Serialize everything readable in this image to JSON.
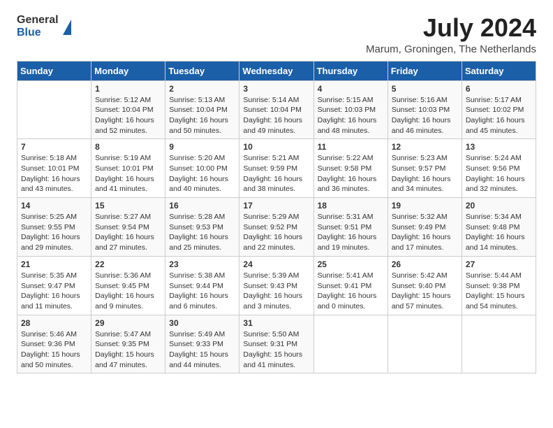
{
  "header": {
    "logo_general": "General",
    "logo_blue": "Blue",
    "title": "July 2024",
    "location": "Marum, Groningen, The Netherlands"
  },
  "weekdays": [
    "Sunday",
    "Monday",
    "Tuesday",
    "Wednesday",
    "Thursday",
    "Friday",
    "Saturday"
  ],
  "weeks": [
    [
      {
        "day": "",
        "content": ""
      },
      {
        "day": "1",
        "content": "Sunrise: 5:12 AM\nSunset: 10:04 PM\nDaylight: 16 hours\nand 52 minutes."
      },
      {
        "day": "2",
        "content": "Sunrise: 5:13 AM\nSunset: 10:04 PM\nDaylight: 16 hours\nand 50 minutes."
      },
      {
        "day": "3",
        "content": "Sunrise: 5:14 AM\nSunset: 10:04 PM\nDaylight: 16 hours\nand 49 minutes."
      },
      {
        "day": "4",
        "content": "Sunrise: 5:15 AM\nSunset: 10:03 PM\nDaylight: 16 hours\nand 48 minutes."
      },
      {
        "day": "5",
        "content": "Sunrise: 5:16 AM\nSunset: 10:03 PM\nDaylight: 16 hours\nand 46 minutes."
      },
      {
        "day": "6",
        "content": "Sunrise: 5:17 AM\nSunset: 10:02 PM\nDaylight: 16 hours\nand 45 minutes."
      }
    ],
    [
      {
        "day": "7",
        "content": "Sunrise: 5:18 AM\nSunset: 10:01 PM\nDaylight: 16 hours\nand 43 minutes."
      },
      {
        "day": "8",
        "content": "Sunrise: 5:19 AM\nSunset: 10:01 PM\nDaylight: 16 hours\nand 41 minutes."
      },
      {
        "day": "9",
        "content": "Sunrise: 5:20 AM\nSunset: 10:00 PM\nDaylight: 16 hours\nand 40 minutes."
      },
      {
        "day": "10",
        "content": "Sunrise: 5:21 AM\nSunset: 9:59 PM\nDaylight: 16 hours\nand 38 minutes."
      },
      {
        "day": "11",
        "content": "Sunrise: 5:22 AM\nSunset: 9:58 PM\nDaylight: 16 hours\nand 36 minutes."
      },
      {
        "day": "12",
        "content": "Sunrise: 5:23 AM\nSunset: 9:57 PM\nDaylight: 16 hours\nand 34 minutes."
      },
      {
        "day": "13",
        "content": "Sunrise: 5:24 AM\nSunset: 9:56 PM\nDaylight: 16 hours\nand 32 minutes."
      }
    ],
    [
      {
        "day": "14",
        "content": "Sunrise: 5:25 AM\nSunset: 9:55 PM\nDaylight: 16 hours\nand 29 minutes."
      },
      {
        "day": "15",
        "content": "Sunrise: 5:27 AM\nSunset: 9:54 PM\nDaylight: 16 hours\nand 27 minutes."
      },
      {
        "day": "16",
        "content": "Sunrise: 5:28 AM\nSunset: 9:53 PM\nDaylight: 16 hours\nand 25 minutes."
      },
      {
        "day": "17",
        "content": "Sunrise: 5:29 AM\nSunset: 9:52 PM\nDaylight: 16 hours\nand 22 minutes."
      },
      {
        "day": "18",
        "content": "Sunrise: 5:31 AM\nSunset: 9:51 PM\nDaylight: 16 hours\nand 19 minutes."
      },
      {
        "day": "19",
        "content": "Sunrise: 5:32 AM\nSunset: 9:49 PM\nDaylight: 16 hours\nand 17 minutes."
      },
      {
        "day": "20",
        "content": "Sunrise: 5:34 AM\nSunset: 9:48 PM\nDaylight: 16 hours\nand 14 minutes."
      }
    ],
    [
      {
        "day": "21",
        "content": "Sunrise: 5:35 AM\nSunset: 9:47 PM\nDaylight: 16 hours\nand 11 minutes."
      },
      {
        "day": "22",
        "content": "Sunrise: 5:36 AM\nSunset: 9:45 PM\nDaylight: 16 hours\nand 9 minutes."
      },
      {
        "day": "23",
        "content": "Sunrise: 5:38 AM\nSunset: 9:44 PM\nDaylight: 16 hours\nand 6 minutes."
      },
      {
        "day": "24",
        "content": "Sunrise: 5:39 AM\nSunset: 9:43 PM\nDaylight: 16 hours\nand 3 minutes."
      },
      {
        "day": "25",
        "content": "Sunrise: 5:41 AM\nSunset: 9:41 PM\nDaylight: 16 hours\nand 0 minutes."
      },
      {
        "day": "26",
        "content": "Sunrise: 5:42 AM\nSunset: 9:40 PM\nDaylight: 15 hours\nand 57 minutes."
      },
      {
        "day": "27",
        "content": "Sunrise: 5:44 AM\nSunset: 9:38 PM\nDaylight: 15 hours\nand 54 minutes."
      }
    ],
    [
      {
        "day": "28",
        "content": "Sunrise: 5:46 AM\nSunset: 9:36 PM\nDaylight: 15 hours\nand 50 minutes."
      },
      {
        "day": "29",
        "content": "Sunrise: 5:47 AM\nSunset: 9:35 PM\nDaylight: 15 hours\nand 47 minutes."
      },
      {
        "day": "30",
        "content": "Sunrise: 5:49 AM\nSunset: 9:33 PM\nDaylight: 15 hours\nand 44 minutes."
      },
      {
        "day": "31",
        "content": "Sunrise: 5:50 AM\nSunset: 9:31 PM\nDaylight: 15 hours\nand 41 minutes."
      },
      {
        "day": "",
        "content": ""
      },
      {
        "day": "",
        "content": ""
      },
      {
        "day": "",
        "content": ""
      }
    ]
  ]
}
